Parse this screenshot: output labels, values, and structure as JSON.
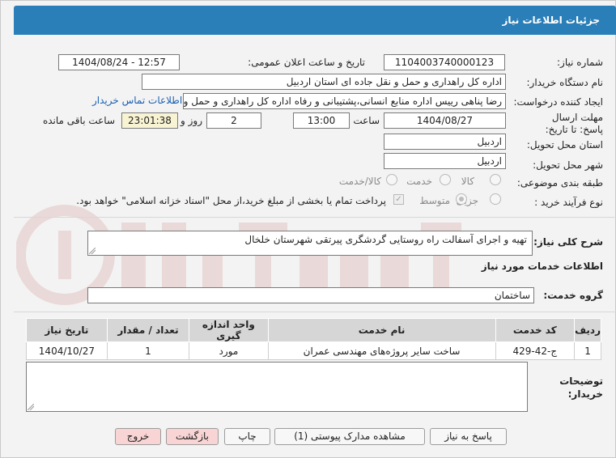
{
  "window": {
    "title": "جزئیات اطلاعات نیاز"
  },
  "labels": {
    "need_number": "شماره نیاز:",
    "announce_datetime": "تاریخ و ساعت اعلان عمومی:",
    "buyer_org": "نام دستگاه خریدار:",
    "requester": "ایجاد کننده درخواست:",
    "deadline": "مهلت ارسال پاسخ: تا تاریخ:",
    "hour": "ساعت",
    "day_and": "روز و",
    "remaining": "ساعت باقی مانده",
    "province": "استان محل تحویل:",
    "city": "شهر محل تحویل:",
    "category": "طبقه بندی موضوعی:",
    "process_type": "نوع فرآیند خرید :",
    "general_desc": "شرح کلی نیاز:",
    "service_info": "اطلاعات خدمات مورد نیاز",
    "service_group": "گروه خدمت:",
    "buyer_notes": "توضیحات خریدار:"
  },
  "values": {
    "need_number": "1104003740000123",
    "announce_datetime": "1404/08/24 - 12:57",
    "buyer_org": "اداره کل راهداری و حمل و نقل جاده ای استان اردبیل",
    "requester": "رضا پناهی رییس اداره منابع انسانی،پشتیبانی و رفاه اداره کل راهداری و حمل و",
    "deadline_date": "1404/08/27",
    "deadline_time": "13:00",
    "days": "2",
    "remaining_time": "23:01:38",
    "province": "اردبیل",
    "city": "اردبیل",
    "general_desc": "تهیه و اجرای آسفالت راه روستایی گردشگری پیرتقی شهرستان خلخال",
    "service_group": "ساختمان",
    "buyer_notes": ""
  },
  "links": {
    "contact": "اطلاعات تماس خریدار"
  },
  "category_options": [
    "کالا",
    "خدمت",
    "کالا/خدمت"
  ],
  "process_options": [
    "جزیی",
    "متوسط"
  ],
  "process_note": "پرداخت تمام یا بخشی از مبلغ خرید،از محل \"اسناد خزانه اسلامی\" خواهد بود.",
  "table": {
    "headers": [
      "ردیف",
      "کد خدمت",
      "نام خدمت",
      "واحد اندازه گیری",
      "تعداد / مقدار",
      "تاریخ نیاز"
    ],
    "rows": [
      [
        "1",
        "ج-42-429",
        "ساخت سایر پروژه‌های مهندسی عمران",
        "مورد",
        "1",
        "1404/10/27"
      ]
    ]
  },
  "buttons": {
    "reply": "پاسخ به نیاز",
    "attachments": "مشاهده مدارک پیوستی (1)",
    "print": "چاپ",
    "back": "بازگشت",
    "exit": "خروج"
  },
  "colors": {
    "titlebar": "#2b7fb9",
    "link": "#1b5fb3",
    "timer_bg": "#f8f4d3",
    "exit_bg": "#f9d4d4"
  }
}
